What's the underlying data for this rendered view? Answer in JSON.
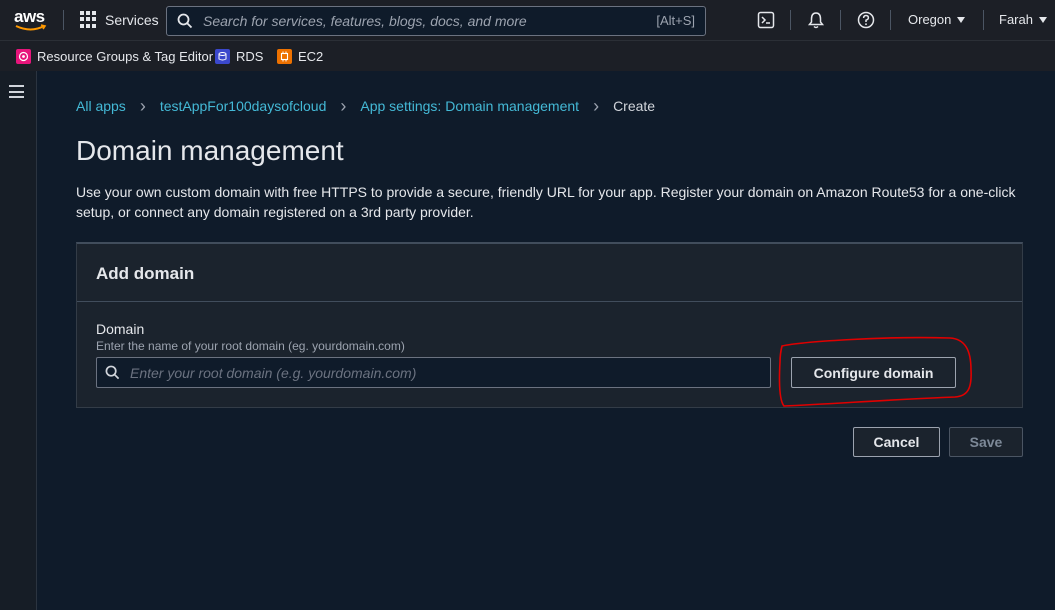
{
  "topnav": {
    "logo": "aws",
    "services_label": "Services",
    "search_placeholder": "Search for services, features, blogs, docs, and more",
    "search_shortcut": "[Alt+S]",
    "icons": [
      "cloudshell-icon",
      "bell-icon",
      "help-icon"
    ],
    "region": "Oregon",
    "user": "Farah"
  },
  "favorites": [
    {
      "label": "Resource Groups & Tag Editor",
      "icon": "resource-groups-icon",
      "color": "#e7157b"
    },
    {
      "label": "RDS",
      "icon": "rds-icon",
      "color": "#3b48cc"
    },
    {
      "label": "EC2",
      "icon": "ec2-icon",
      "color": "#ed7100"
    }
  ],
  "breadcrumb": {
    "items": [
      "All apps",
      "testAppFor100daysofcloud",
      "App settings: Domain management"
    ],
    "current": "Create"
  },
  "page": {
    "title": "Domain management",
    "description": "Use your own custom domain with free HTTPS to provide a secure, friendly URL for your app. Register your domain on Amazon Route53 for a one-click setup, or connect any domain registered on a 3rd party provider."
  },
  "panel": {
    "title": "Add domain",
    "field_label": "Domain",
    "field_description": "Enter the name of your root domain (eg. yourdomain.com)",
    "input_placeholder": "Enter your root domain (e.g. yourdomain.com)",
    "input_value": "",
    "configure_button": "Configure domain"
  },
  "actions": {
    "cancel": "Cancel",
    "save": "Save"
  },
  "colors": {
    "link": "#44b9d6",
    "background": "#0f1b2a",
    "nav": "#1c1f26",
    "annotation": "#e00000"
  }
}
